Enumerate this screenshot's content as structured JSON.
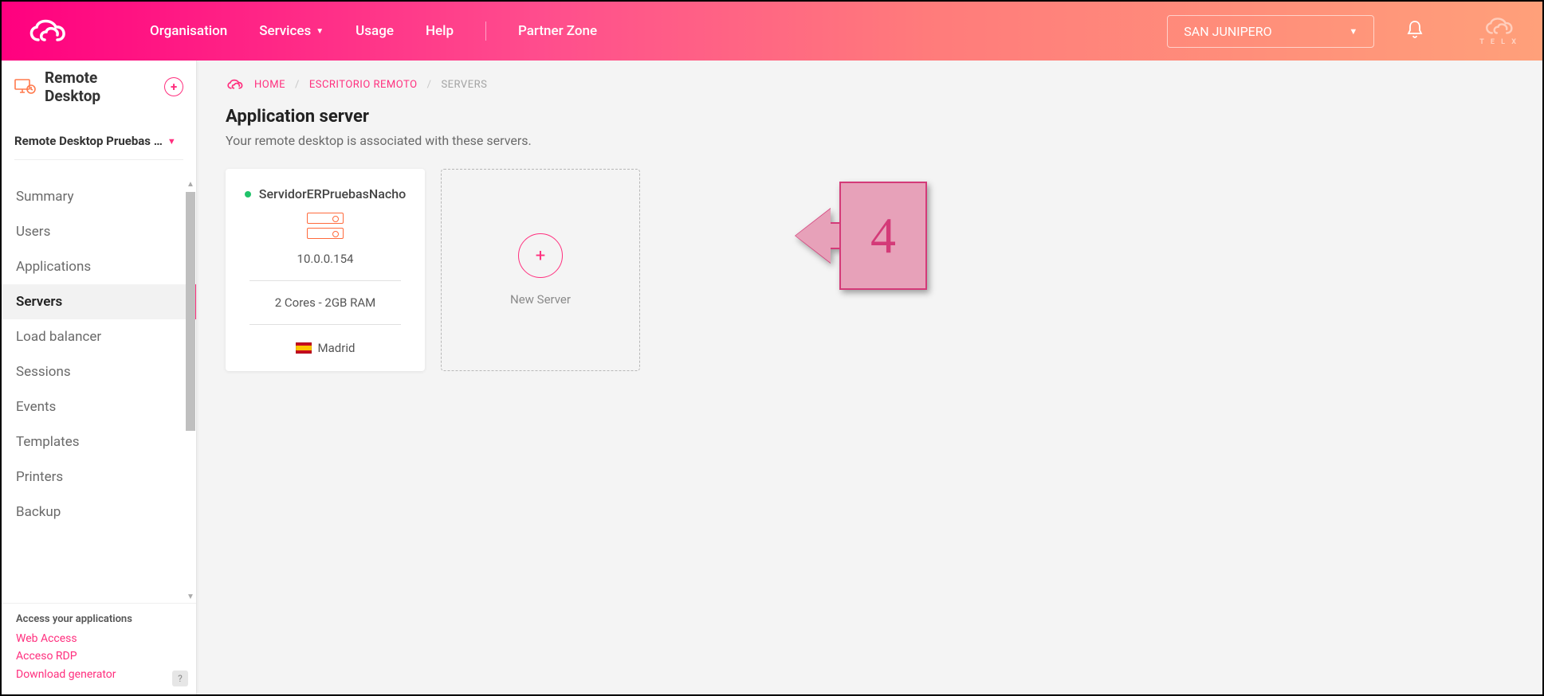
{
  "header": {
    "nav": {
      "organisation": "Organisation",
      "services": "Services",
      "usage": "Usage",
      "help": "Help",
      "partner": "Partner Zone"
    },
    "tenant": "SAN JUNIPERO"
  },
  "sidebar": {
    "title": "Remote Desktop",
    "project": "Remote Desktop Pruebas …",
    "items": {
      "summary": "Summary",
      "users": "Users",
      "applications": "Applications",
      "servers": "Servers",
      "load_balancer": "Load balancer",
      "sessions": "Sessions",
      "events": "Events",
      "templates": "Templates",
      "printers": "Printers",
      "backup": "Backup"
    },
    "footer": {
      "heading": "Access your applications",
      "web": "Web Access",
      "rdp": "Acceso RDP",
      "download": "Download generator",
      "help": "?"
    }
  },
  "breadcrumb": {
    "home": "HOME",
    "remote": "ESCRITORIO REMOTO",
    "current": "SERVERS"
  },
  "page": {
    "title": "Application server",
    "subtitle": "Your remote desktop is associated with these servers."
  },
  "server": {
    "name": "ServidorERPruebasNacho",
    "ip": "10.0.0.154",
    "specs": "2 Cores - 2GB RAM",
    "location": "Madrid"
  },
  "new_server": {
    "label": "New Server",
    "plus": "+"
  },
  "callout": {
    "num": "4"
  }
}
